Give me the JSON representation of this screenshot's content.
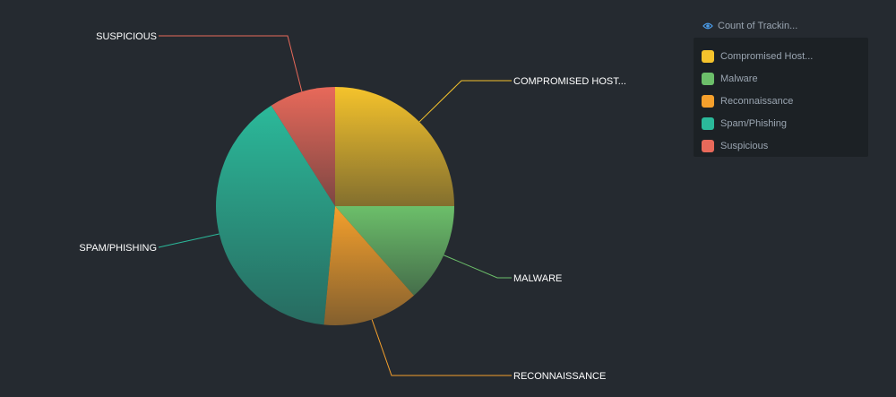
{
  "legend": {
    "title": "Count of Trackin...",
    "icon": "eye-icon",
    "items": [
      {
        "label": "Compromised Host...",
        "color": "#f5c32c"
      },
      {
        "label": "Malware",
        "color": "#6cbf6a"
      },
      {
        "label": "Reconnaissance",
        "color": "#f5a02c"
      },
      {
        "label": "Spam/Phishing",
        "color": "#2bb99a"
      },
      {
        "label": "Suspicious",
        "color": "#e8695a"
      }
    ]
  },
  "chart_data": {
    "type": "pie",
    "start_angle": "12 o'clock, clockwise",
    "grid": false,
    "legend_position": "top-right",
    "slices": [
      {
        "name": "Compromised Host...",
        "callout": "COMPROMISED HOST...",
        "value": 25.0,
        "color": "#f5c32c"
      },
      {
        "name": "Malware",
        "callout": "MALWARE",
        "value": 13.5,
        "color": "#6cbf6a"
      },
      {
        "name": "Reconnaissance",
        "callout": "RECONNAISSANCE",
        "value": 13.0,
        "color": "#f5a02c"
      },
      {
        "name": "Spam/Phishing",
        "callout": "SPAM/PHISHING",
        "value": 39.5,
        "color": "#2bb99a"
      },
      {
        "name": "Suspicious",
        "callout": "SUSPICIOUS",
        "value": 9.0,
        "color": "#e8695a"
      }
    ]
  }
}
